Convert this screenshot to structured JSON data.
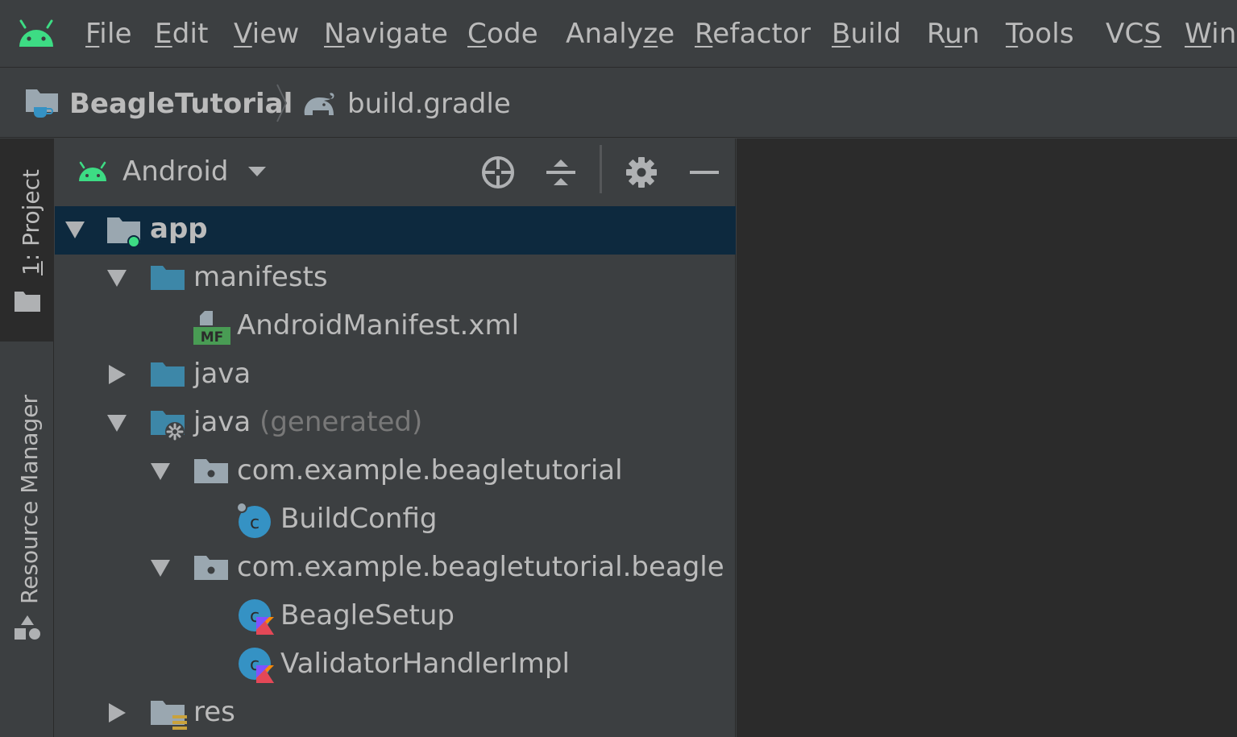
{
  "menu": {
    "items": [
      "File",
      "Edit",
      "View",
      "Navigate",
      "Code",
      "Analyze",
      "Refactor",
      "Build",
      "Run",
      "Tools",
      "VCS",
      "Win"
    ],
    "mnemonics": [
      "F",
      "E",
      "V",
      "N",
      "C",
      "z",
      "R",
      "B",
      "u",
      "T",
      "S",
      "W"
    ]
  },
  "breadcrumb": {
    "project": "BeagleTutorial",
    "file": "build.gradle"
  },
  "stripe": {
    "project_tab": "1: Project",
    "resource_tab": "Resource Manager"
  },
  "panel": {
    "view_mode": "Android"
  },
  "tree": {
    "app": "app",
    "manifests": "manifests",
    "android_manifest": "AndroidManifest.xml",
    "java": "java",
    "java_generated": "java",
    "java_generated_suffix": "(generated)",
    "pkg1": "com.example.beagletutorial",
    "build_config": "BuildConfig",
    "pkg2": "com.example.beagletutorial.beagle",
    "beagle_setup": "BeagleSetup",
    "validator_handler": "ValidatorHandlerImpl",
    "res": "res",
    "manifest_badge": "MF"
  },
  "colors": {
    "android_green": "#3ddc84",
    "folder_blue": "#3d87a8",
    "folder_gray": "#9aa7b0",
    "selection": "#0d293e",
    "class_blue": "#3592c4",
    "manifest_green": "#499c54"
  }
}
